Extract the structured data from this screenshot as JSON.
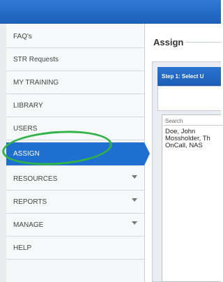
{
  "sidebar": {
    "items": [
      {
        "label": "FAQ's",
        "has_submenu": false,
        "active": false
      },
      {
        "label": "STR Requests",
        "has_submenu": false,
        "active": false
      },
      {
        "label": "MY TRAINING",
        "has_submenu": false,
        "active": false
      },
      {
        "label": "LIBRARY",
        "has_submenu": false,
        "active": false
      },
      {
        "label": "USERS",
        "has_submenu": false,
        "active": false
      },
      {
        "label": "ASSIGN",
        "has_submenu": false,
        "active": true
      },
      {
        "label": "RESOURCES",
        "has_submenu": true,
        "active": false
      },
      {
        "label": "REPORTS",
        "has_submenu": true,
        "active": false
      },
      {
        "label": "MANAGE",
        "has_submenu": true,
        "active": false
      },
      {
        "label": "HELP",
        "has_submenu": false,
        "active": false
      }
    ]
  },
  "main": {
    "title": "Assign",
    "step": {
      "header": "Step 1: Select U"
    },
    "search": {
      "placeholder": "Search",
      "value": ""
    },
    "users": [
      "Doe, John",
      "Mossholder, Th",
      "OnCall, NAS"
    ]
  },
  "colors": {
    "header_blue": "#1f6fd0",
    "annotation_green": "#31b34a"
  }
}
